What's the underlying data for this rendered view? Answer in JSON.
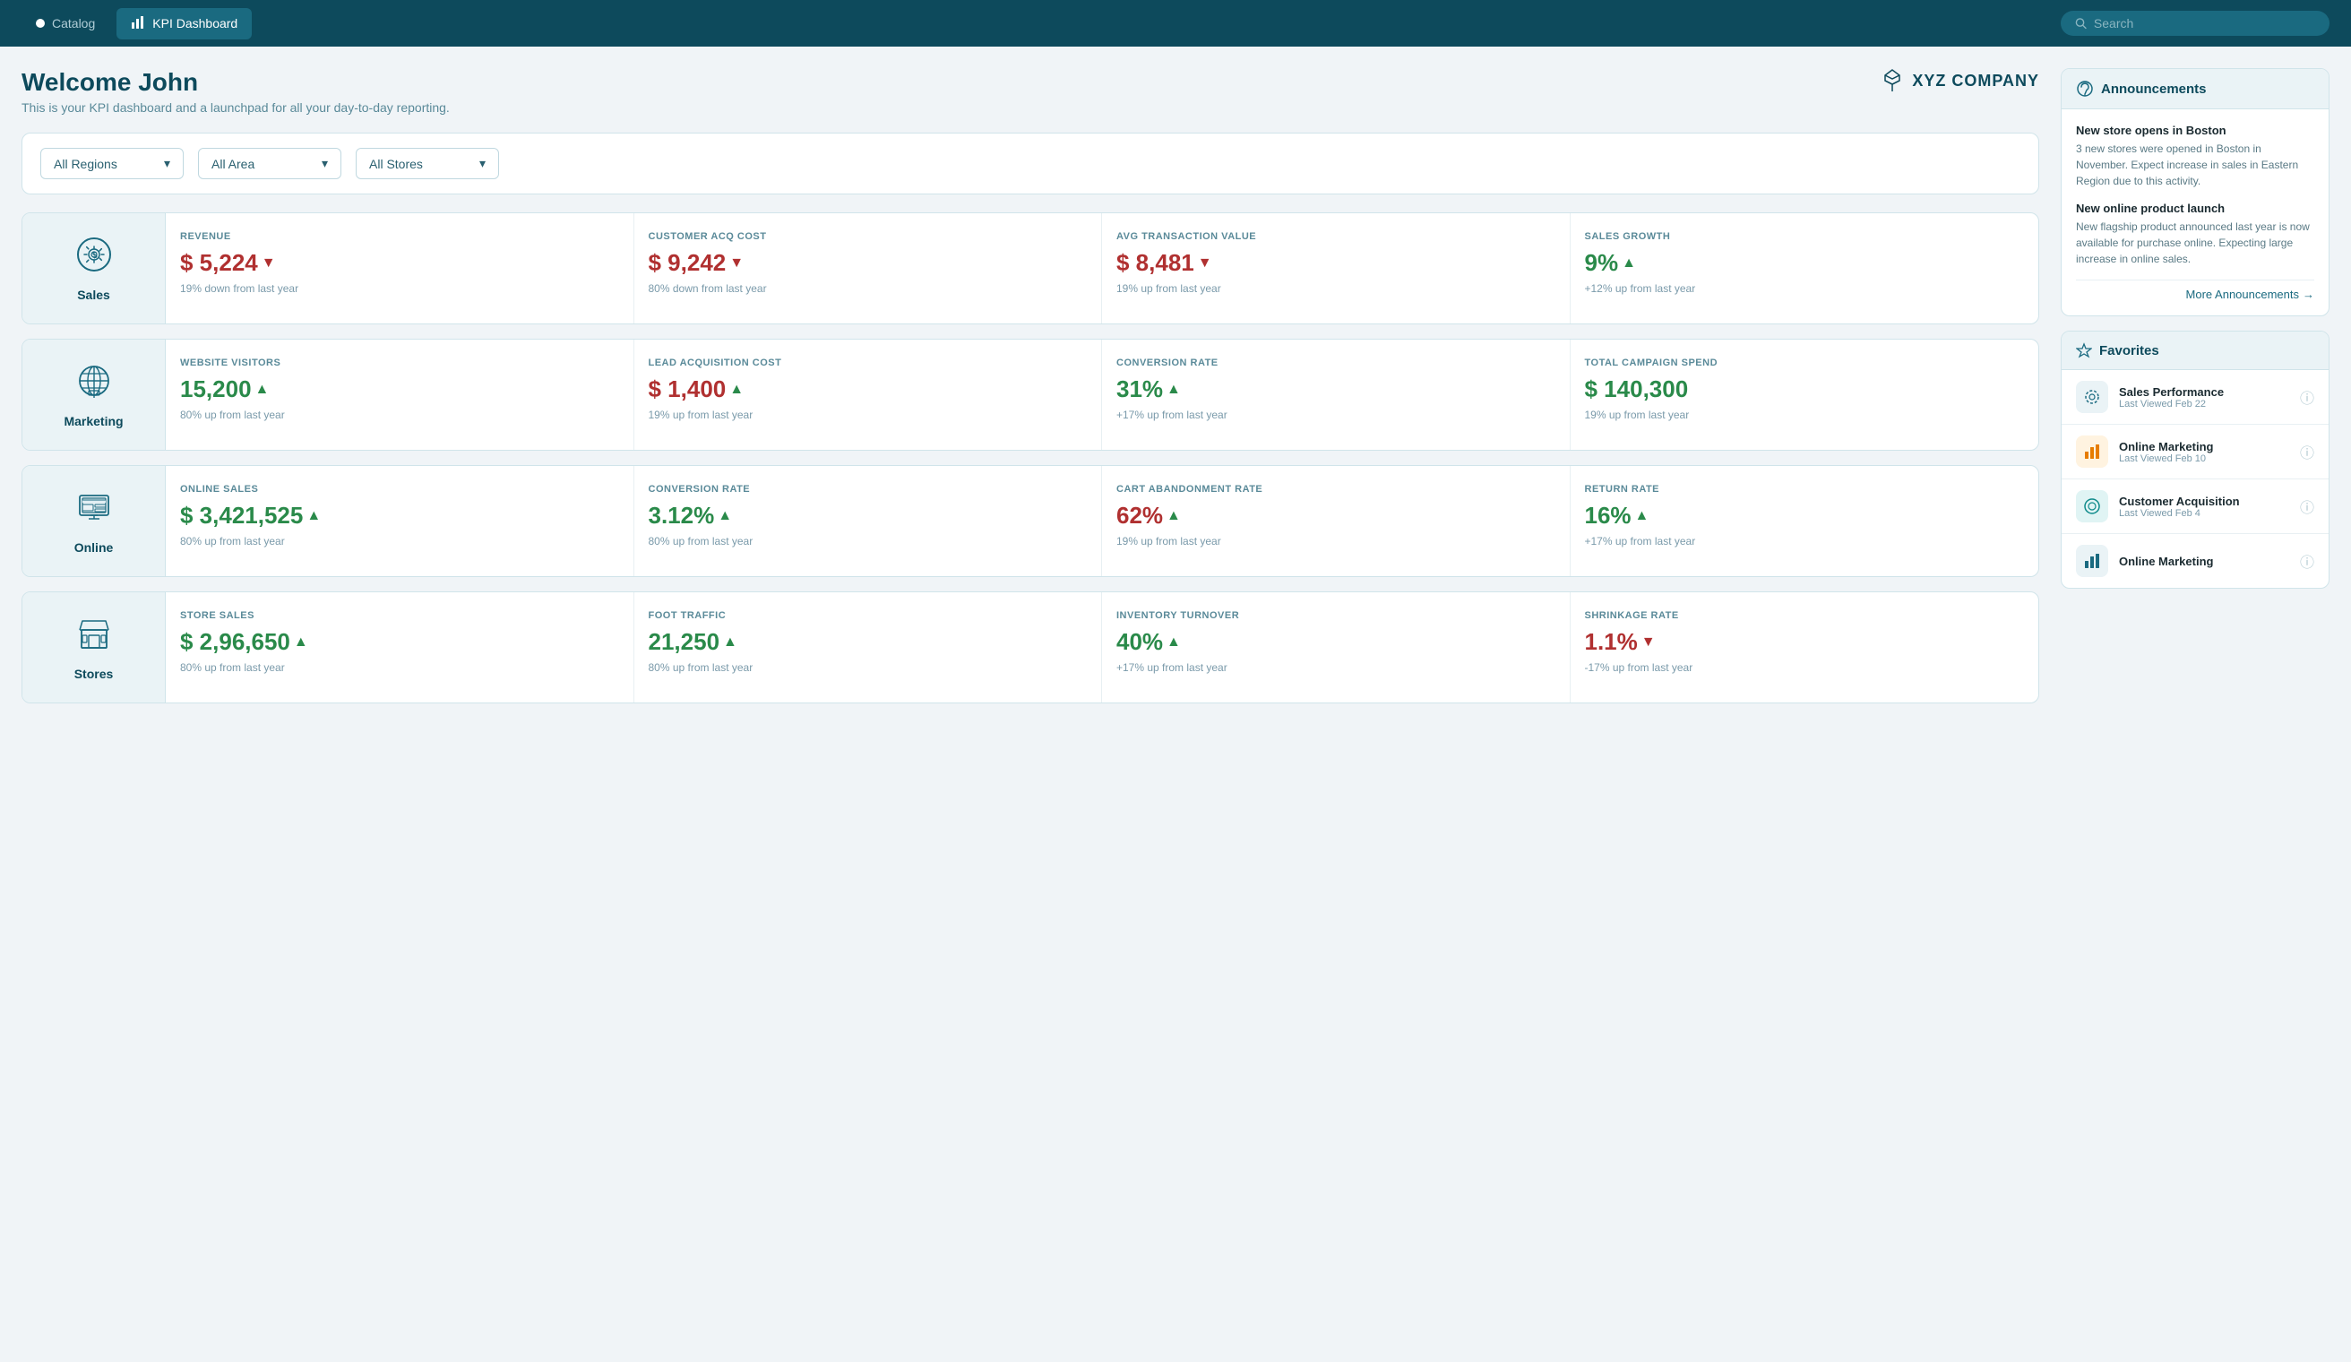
{
  "nav": {
    "catalog_label": "Catalog",
    "kpi_label": "KPI Dashboard",
    "search_placeholder": "Search"
  },
  "header": {
    "welcome": "Welcome John",
    "subtitle": "This is your KPI dashboard and a launchpad for all your day-to-day reporting.",
    "company": "XYZ COMPANY"
  },
  "filters": {
    "region": "All Regions",
    "area": "All Area",
    "store": "All Stores"
  },
  "sections": [
    {
      "id": "sales",
      "label": "Sales",
      "icon": "gear-dollar",
      "cards": [
        {
          "label": "REVENUE",
          "value": "$ 5,224",
          "color": "red",
          "arrow": "down",
          "sub": "19% down from last year"
        },
        {
          "label": "CUSTOMER ACQ COST",
          "value": "$ 9,242",
          "color": "red",
          "arrow": "down",
          "sub": "80% down from last year"
        },
        {
          "label": "AVG TRANSACTION VALUE",
          "value": "$ 8,481",
          "color": "red",
          "arrow": "down",
          "sub": "19% up from last year"
        },
        {
          "label": "SALES GROWTH",
          "value": "9%",
          "color": "green",
          "arrow": "up",
          "sub": "+12% up from last year"
        }
      ]
    },
    {
      "id": "marketing",
      "label": "Marketing",
      "icon": "globe",
      "cards": [
        {
          "label": "WEBSITE VISITORS",
          "value": "15,200",
          "color": "green",
          "arrow": "up",
          "sub": "80% up from last year"
        },
        {
          "label": "LEAD ACQUISITION COST",
          "value": "$ 1,400",
          "color": "red",
          "arrow": "up",
          "sub": "19% up from last year"
        },
        {
          "label": "CONVERSION RATE",
          "value": "31%",
          "color": "green",
          "arrow": "up",
          "sub": "+17% up from last year"
        },
        {
          "label": "TOTAL CAMPAIGN SPEND",
          "value": "$ 140,300",
          "color": "green",
          "arrow": null,
          "sub": "19% up from last year"
        }
      ]
    },
    {
      "id": "online",
      "label": "Online",
      "icon": "monitor",
      "cards": [
        {
          "label": "ONLINE SALES",
          "value": "$ 3,421,525",
          "color": "green",
          "arrow": "up",
          "sub": "80% up from last year"
        },
        {
          "label": "CONVERSION RATE",
          "value": "3.12%",
          "color": "green",
          "arrow": "up",
          "sub": "80% up from last year"
        },
        {
          "label": "CART ABANDONMENT RATE",
          "value": "62%",
          "color": "red",
          "arrow": "up",
          "sub": "19% up from last year"
        },
        {
          "label": "RETURN RATE",
          "value": "16%",
          "color": "green",
          "arrow": "up",
          "sub": "+17% up from last year"
        }
      ]
    },
    {
      "id": "stores",
      "label": "Stores",
      "icon": "store",
      "cards": [
        {
          "label": "STORE SALES",
          "value": "$ 2,96,650",
          "color": "green",
          "arrow": "up",
          "sub": "80% up from last year"
        },
        {
          "label": "FOOT TRAFFIC",
          "value": "21,250",
          "color": "green",
          "arrow": "up",
          "sub": "80% up from last year"
        },
        {
          "label": "INVENTORY TURNOVER",
          "value": "40%",
          "color": "green",
          "arrow": "up",
          "sub": "+17% up from last year"
        },
        {
          "label": "SHRINKAGE RATE",
          "value": "1.1%",
          "color": "red",
          "arrow": "down",
          "sub": "-17% up from last year"
        }
      ]
    }
  ],
  "announcements": {
    "title": "Announcements",
    "items": [
      {
        "title": "New store opens in Boston",
        "text": "3 new stores were opened in Boston in November. Expect increase in sales in Eastern Region due to this activity."
      },
      {
        "title": "New online product launch",
        "text": "New flagship product announced last year is now available for purchase online. Expecting large increase in online sales."
      }
    ],
    "more_label": "More Announcements"
  },
  "favorites": {
    "title": "Favorites",
    "items": [
      {
        "name": "Sales Performance",
        "sub": "Last Viewed Feb 22",
        "icon_type": "spinner"
      },
      {
        "name": "Online Marketing",
        "sub": "Last Viewed Feb 10",
        "icon_type": "bar-chart"
      },
      {
        "name": "Customer Acquisition",
        "sub": "Last Viewed Feb 4",
        "icon_type": "circle"
      },
      {
        "name": "Online Marketing",
        "sub": "",
        "icon_type": "bar-chart-partial"
      }
    ]
  }
}
